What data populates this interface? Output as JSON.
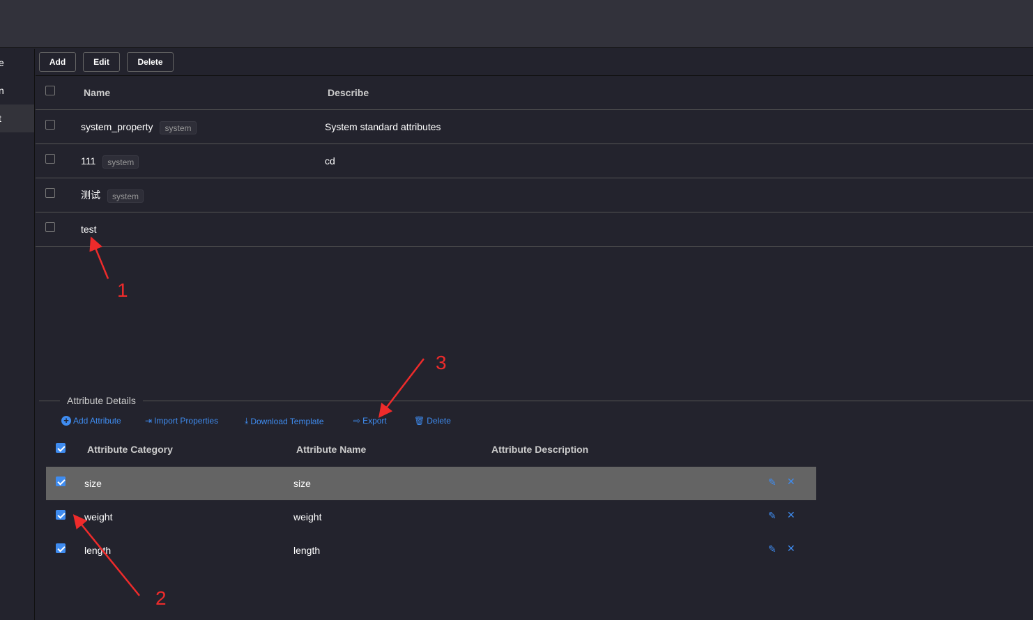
{
  "sidebar": {
    "items": [
      {
        "label": "e"
      },
      {
        "label": "n"
      },
      {
        "label": "t"
      }
    ]
  },
  "toolbar": {
    "add": "Add",
    "edit": "Edit",
    "delete": "Delete"
  },
  "table": {
    "headers": {
      "name": "Name",
      "describe": "Describe"
    },
    "rows": [
      {
        "name": "system_property",
        "tag": "system",
        "describe": "System standard attributes"
      },
      {
        "name": "111",
        "tag": "system",
        "describe": "cd"
      },
      {
        "name": "测试",
        "tag": "system",
        "describe": ""
      },
      {
        "name": "test",
        "tag": "",
        "describe": ""
      }
    ]
  },
  "details": {
    "title": "Attribute Details",
    "actions": {
      "add": "Add Attribute",
      "import": "Import Properties",
      "download": "Download Template",
      "export": "Export",
      "delete": "Delete"
    },
    "headers": {
      "category": "Attribute Category",
      "name": "Attribute Name",
      "description": "Attribute Description"
    },
    "rows": [
      {
        "category": "size",
        "name": "size",
        "checked": true
      },
      {
        "category": "weight",
        "name": "weight",
        "checked": true
      },
      {
        "category": "length",
        "name": "length",
        "checked": true
      }
    ]
  },
  "annotations": {
    "n1": "1",
    "n2": "2",
    "n3": "3",
    "color": "#ee2b2b"
  },
  "colors": {
    "accent": "#3f8cf0",
    "background": "#23232d",
    "selected_row": "#646464"
  }
}
